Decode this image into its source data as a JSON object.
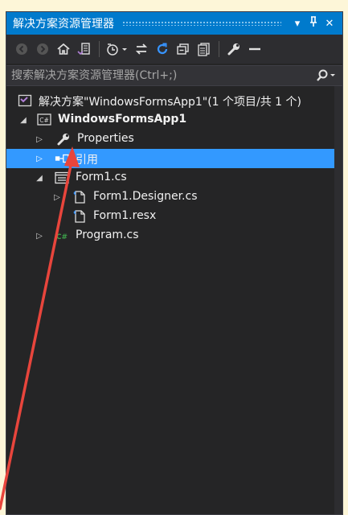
{
  "panel": {
    "title": "解决方案资源管理器",
    "buttons": {
      "dropdown": "▾",
      "pin": "⊥",
      "close": "✕"
    }
  },
  "toolbar": {
    "icons": [
      "back-icon",
      "forward-icon",
      "home-icon",
      "switch-views-icon",
      "pending-changes-icon",
      "sync-icon",
      "refresh-icon",
      "collapse-all-icon",
      "show-all-files-icon",
      "properties-icon",
      "preview-icon"
    ]
  },
  "search": {
    "placeholder": "搜索解决方案资源管理器(Ctrl+;)"
  },
  "tree": {
    "solution": {
      "label": "解决方案\"WindowsFormsApp1\"(1 个项目/共 1 个)"
    },
    "project": {
      "label": "WindowsFormsApp1",
      "badge": "C#"
    },
    "properties": {
      "label": "Properties"
    },
    "references": {
      "label": "引用"
    },
    "form1": {
      "label": "Form1.cs"
    },
    "designer": {
      "label": "Form1.Designer.cs"
    },
    "resx": {
      "label": "Form1.resx"
    },
    "program": {
      "label": "Program.cs",
      "badge": "C#"
    }
  },
  "colors": {
    "accent": "#007acc",
    "selection": "#3399ff",
    "background": "#252526",
    "annotation": "#e8453c"
  }
}
